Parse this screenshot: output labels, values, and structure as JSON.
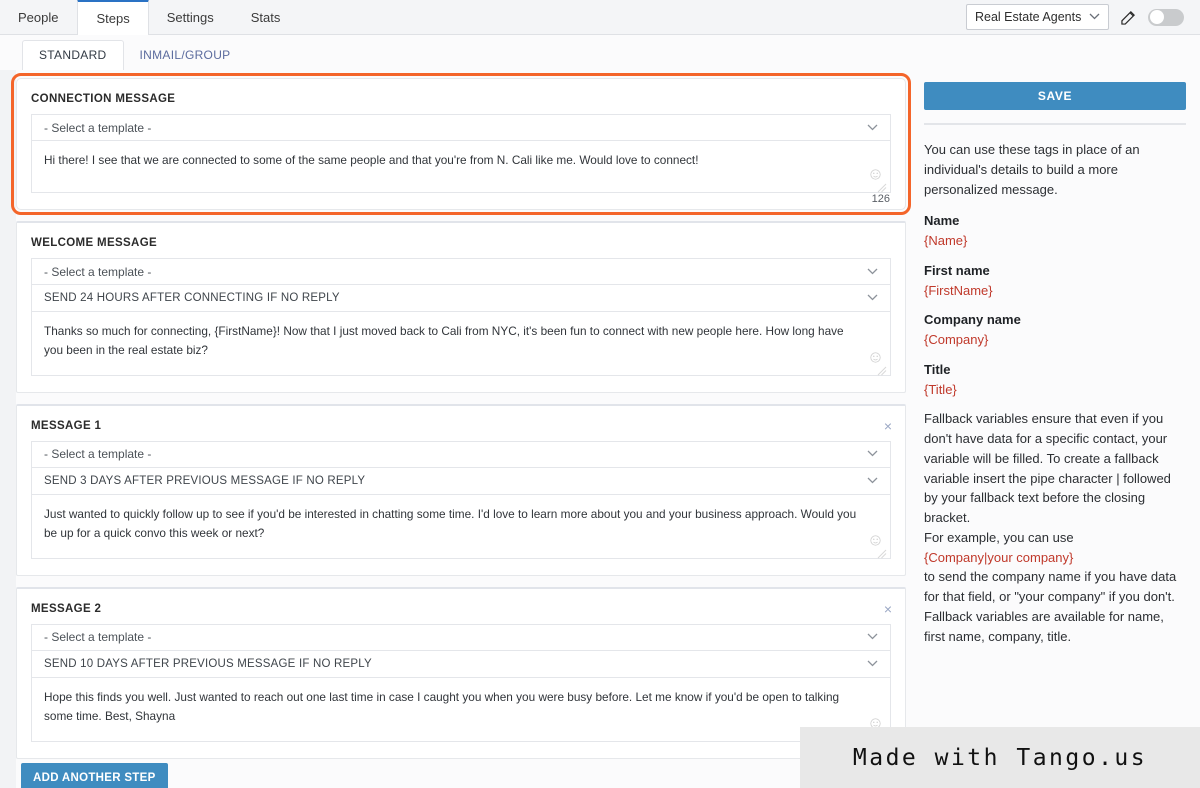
{
  "topbar": {
    "tabs": [
      {
        "label": "People",
        "active": false
      },
      {
        "label": "Steps",
        "active": true
      },
      {
        "label": "Settings",
        "active": false
      },
      {
        "label": "Stats",
        "active": false
      }
    ],
    "audience_value": "Real Estate Agents",
    "chevron": "⌄",
    "edit_icon": "edit-icon",
    "toggle_state": "off"
  },
  "subtabs": [
    {
      "label": "STANDARD",
      "active": true
    },
    {
      "label": "INMAIL/GROUP",
      "active": false
    }
  ],
  "steps": {
    "connection": {
      "title": "CONNECTION MESSAGE",
      "template_placeholder": "- Select a template -",
      "message": "Hi there! I see that we are connected to some of the same people and that you're from N. Cali like me. Would love to connect!",
      "char_count": "126"
    },
    "welcome": {
      "title": "WELCOME MESSAGE",
      "template_placeholder": "- Select a template -",
      "timing": "SEND 24 HOURS AFTER CONNECTING IF NO REPLY",
      "message": "Thanks so much for connecting, {FirstName}! Now that I just moved back to Cali from NYC, it's been fun to connect with new people here. How long have you been in the real estate biz?"
    },
    "message1": {
      "title": "MESSAGE 1",
      "template_placeholder": "- Select a template -",
      "timing": "SEND 3 DAYS AFTER PREVIOUS MESSAGE IF NO REPLY",
      "message": "Just wanted to quickly follow up to see if you'd be interested in chatting some time. I'd love to learn more about you and your business approach. Would you be up for a quick convo this week or next?",
      "close": "×"
    },
    "message2": {
      "title": "MESSAGE 2",
      "template_placeholder": "- Select a template -",
      "timing": "SEND 10 DAYS AFTER PREVIOUS MESSAGE IF NO REPLY",
      "message": "Hope this finds you well. Just wanted to reach out one last time in case I caught you when you were busy before. Let me know if you'd be open to talking some time. Best, Shayna",
      "close": "×"
    },
    "add_step_label": "ADD ANOTHER STEP"
  },
  "sidebar": {
    "save_label": "SAVE",
    "intro": "You can use these tags in place of an individual's details to build a more personalized message.",
    "tags": [
      {
        "label": "Name",
        "value": "{Name}"
      },
      {
        "label": "First name",
        "value": "{FirstName}"
      },
      {
        "label": "Company name",
        "value": "{Company}"
      },
      {
        "label": "Title",
        "value": "{Title}"
      }
    ],
    "fallback_para1": "Fallback variables ensure that even if you don't have data for a specific contact, your variable will be filled. To create a fallback variable insert the pipe character | followed by your fallback text before the closing bracket.",
    "fallback_example_lead": "For example, you can use",
    "fallback_example_tag": "{Company|your company}",
    "fallback_para2": "to send the company name if you have data for that field, or \"your company\" if you don't. Fallback variables are available for name, first name, company, title."
  },
  "watermark": {
    "text": "Made with Tango.us"
  },
  "colors": {
    "accent_blue": "#3f8cc0",
    "active_tab_blue": "#2a72c4",
    "highlight_orange": "#f4652a",
    "tag_red": "#c0392b",
    "link_blue": "#5b6b9e"
  }
}
